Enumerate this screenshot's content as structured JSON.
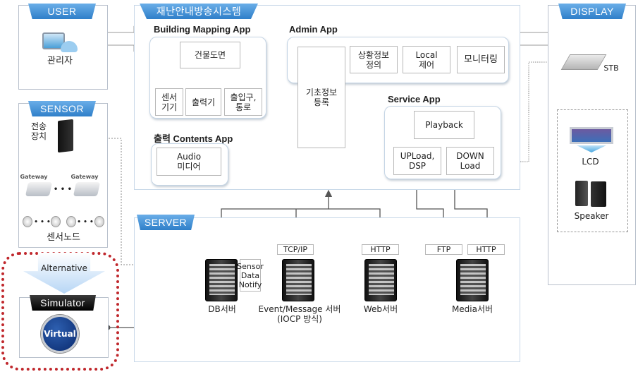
{
  "title": "재난안내방송시스템",
  "user": {
    "header": "USER",
    "admin_label": "관리자"
  },
  "sensor": {
    "header": "SENSOR",
    "transmitter_label": "전송\n장치",
    "gateway_label": "Gateway",
    "ellipsis": "• • •",
    "node_label": "센서노드"
  },
  "simulator": {
    "alternative_label": "Alternative",
    "header": "Simulator",
    "virtual_label": "Virtual"
  },
  "building_mapping_app": {
    "title": "Building Mapping App",
    "floor_plan": "건물도면",
    "children": [
      "센서\n기기",
      "출력기",
      "출입구,\n통로"
    ]
  },
  "admin_app": {
    "title": "Admin App",
    "items": [
      "상황정보\n정의",
      "Local\n제어",
      "모니터링"
    ],
    "basic_info": "기초정보\n등록"
  },
  "service_app": {
    "title": "Service App",
    "playback": "Playback",
    "upload": "UPLoad,\nDSP",
    "download": "DOWN\nLoad"
  },
  "contents_app": {
    "title": "출력 Contents App",
    "media": "Audio\n미디어"
  },
  "server": {
    "header": "SERVER",
    "sensor_notify": "Sensor\nData\nNotify",
    "servers": [
      {
        "name": "DB서버",
        "protocols": []
      },
      {
        "name": "Event/Message 서버\n(IOCP 방식)",
        "protocols": [
          "TCP/IP"
        ]
      },
      {
        "name": "Web서버",
        "protocols": [
          "HTTP"
        ]
      },
      {
        "name": "Media서버",
        "protocols": [
          "FTP",
          "HTTP"
        ]
      }
    ]
  },
  "display": {
    "header": "DISPLAY",
    "stb_label": "STB",
    "lcd_label": "LCD",
    "speaker_label": "Speaker"
  },
  "colors": {
    "ribbon_blue": "#2f7fc9",
    "highlight_red": "#c0282d"
  }
}
